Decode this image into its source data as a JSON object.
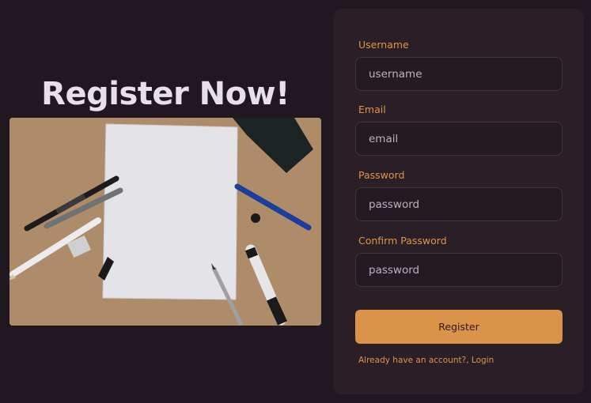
{
  "hero": {
    "title": "Register Now!",
    "image": "paper-and-pens-photo"
  },
  "form": {
    "username": {
      "label": "Username",
      "placeholder": "username"
    },
    "email": {
      "label": "Email",
      "placeholder": "email"
    },
    "password": {
      "label": "Password",
      "placeholder": "password"
    },
    "confirm_password": {
      "label": "Confirm Password",
      "placeholder": "password"
    },
    "submit_label": "Register",
    "login_link_text": "Already have an account?, Login"
  },
  "colors": {
    "background": "#211720",
    "card": "#2a1e27",
    "accent": "#da9349",
    "label": "#e0944a",
    "title": "#e6e1e8"
  }
}
